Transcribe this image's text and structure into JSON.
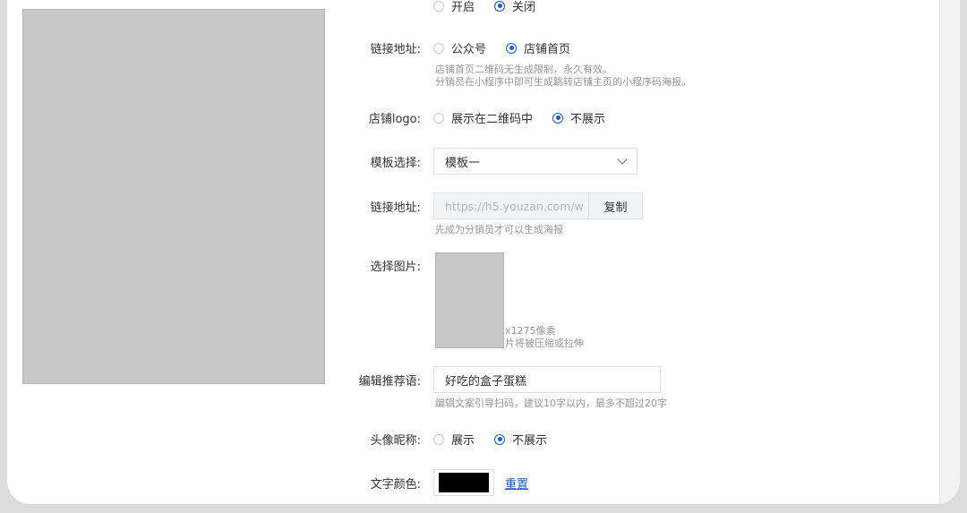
{
  "top_partial": {
    "opt1": "开启",
    "opt2": "关闭"
  },
  "link_address": {
    "label": "链接地址:",
    "options": [
      "公众号",
      "店铺首页"
    ],
    "help": [
      "店铺首页二维码无生成限制，永久有效。",
      "分销员在小程序中即可生成跳转店铺主页的小程序码海报。"
    ]
  },
  "logo": {
    "label": "店铺logo:",
    "options": [
      "展示在二维码中",
      "不展示"
    ]
  },
  "template": {
    "label": "模板选择:",
    "value": "模板一"
  },
  "link2": {
    "label": "链接地址:",
    "placeholder": "https://h5.youzan.com/w",
    "copy": "复制",
    "help": "先成为分销员才可以生成海报"
  },
  "image": {
    "label": "选择图片:",
    "size_note": "x1275像素",
    "warn_note": "片将被压缩或拉伸"
  },
  "recommend": {
    "label": "编辑推荐语:",
    "value": "好吃的盒子蛋糕",
    "help": "编辑文案引导扫码，建议10字以内，最多不超过20字"
  },
  "nickname": {
    "label": "头像昵称:",
    "options": [
      "展示",
      "不展示"
    ]
  },
  "text_color": {
    "label": "文字颜色:",
    "swatch": "#000000",
    "reset": "重置"
  }
}
